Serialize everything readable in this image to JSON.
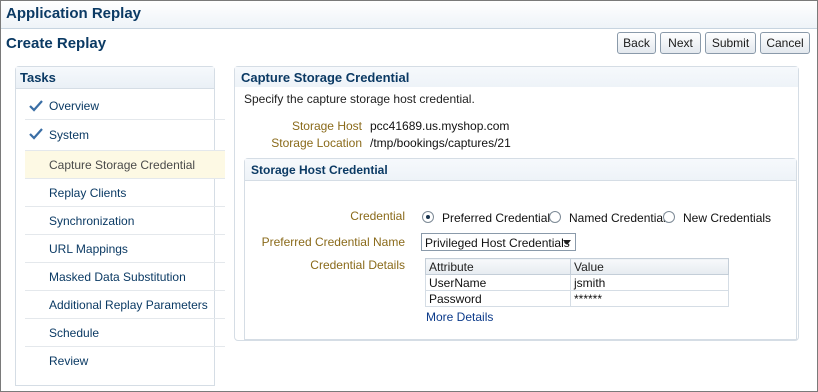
{
  "app": {
    "title": "Application Replay"
  },
  "page": {
    "title": "Create Replay"
  },
  "buttons": {
    "back": "Back",
    "next": "Next",
    "submit": "Submit",
    "cancel": "Cancel"
  },
  "tasks": {
    "title": "Tasks",
    "items": [
      {
        "label": "Overview",
        "done": true
      },
      {
        "label": "System",
        "done": true
      },
      {
        "label": "Capture Storage Credential",
        "current": true
      },
      {
        "label": "Replay Clients"
      },
      {
        "label": "Synchronization"
      },
      {
        "label": "URL Mappings"
      },
      {
        "label": "Masked Data Substitution"
      },
      {
        "label": "Additional Replay Parameters"
      },
      {
        "label": "Schedule"
      },
      {
        "label": "Review"
      }
    ]
  },
  "main": {
    "title": "Capture Storage Credential",
    "instruction": "Specify the capture storage host credential.",
    "storage_host_label": "Storage Host",
    "storage_host_value": "pcc41689.us.myshop.com",
    "storage_location_label": "Storage Location",
    "storage_location_value": "/tmp/bookings/captures/21"
  },
  "credential_section": {
    "title": "Storage Host Credential",
    "credential_label": "Credential",
    "options": [
      "Preferred Credential",
      "Named Credential",
      "New Credentials"
    ],
    "selected_option": "Preferred Credential",
    "preferred_name_label": "Preferred Credential Name",
    "preferred_name_value": "Privileged Host Credentials",
    "details_label": "Credential Details",
    "table": {
      "headers": [
        "Attribute",
        "Value"
      ],
      "rows": [
        [
          "UserName",
          "jsmith"
        ],
        [
          "Password",
          "******"
        ]
      ]
    },
    "more_details": "More Details"
  },
  "colors": {
    "title_blue": "#0b3a64",
    "label_gold": "#8a6a1a",
    "current_task_bg": "#fdf9e4",
    "check_blue": "#3a6ea5"
  }
}
